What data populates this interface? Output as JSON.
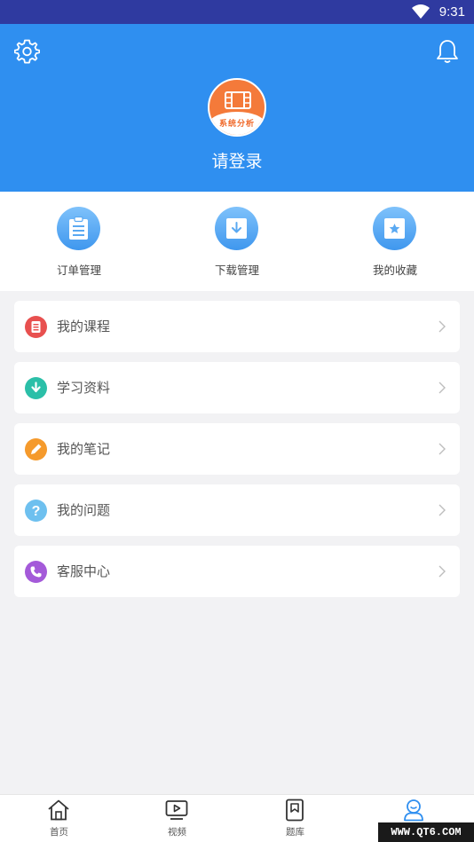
{
  "status_bar": {
    "time": "9:31"
  },
  "profile": {
    "avatar_caption": "系统分析",
    "login_text": "请登录"
  },
  "shortcuts": [
    {
      "label": "订单管理",
      "icon": "clipboard-icon"
    },
    {
      "label": "下载管理",
      "icon": "download-box-icon"
    },
    {
      "label": "我的收藏",
      "icon": "star-box-icon"
    }
  ],
  "menu": [
    {
      "label": "我的课程",
      "icon": "list-icon",
      "color": "#e8504f"
    },
    {
      "label": "学习资料",
      "icon": "download-arrow-icon",
      "color": "#2bbfa8"
    },
    {
      "label": "我的笔记",
      "icon": "pencil-icon",
      "color": "#f59a2c"
    },
    {
      "label": "我的问题",
      "icon": "question-icon",
      "color": "#6ec0ef"
    },
    {
      "label": "客服中心",
      "icon": "phone-icon",
      "color": "#a45ad9"
    }
  ],
  "tabbar": [
    {
      "label": "首页",
      "icon": "home-icon",
      "active": false
    },
    {
      "label": "视频",
      "icon": "video-icon",
      "active": false
    },
    {
      "label": "题库",
      "icon": "bookmark-icon",
      "active": false
    },
    {
      "label": "",
      "icon": "profile-icon",
      "active": true
    }
  ],
  "watermark": "WWW.QT6.COM",
  "colors": {
    "header": "#2f8ff0",
    "status_bar": "#2f3aa0",
    "accent": "#2f8ff0"
  }
}
